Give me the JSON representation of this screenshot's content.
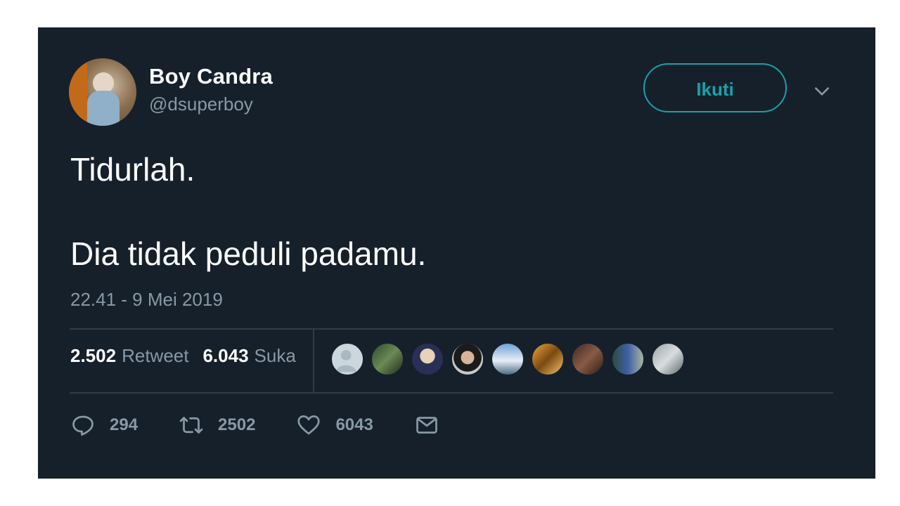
{
  "tweet": {
    "author": {
      "name": "Boy Candra",
      "handle": "@dsuperboy"
    },
    "follow_label": "Ikuti",
    "more_icon": "chevron-down-icon",
    "text_lines": [
      "Tidurlah.",
      "Dia tidak peduli padamu."
    ],
    "timestamp": "22.41 - 9 Mei 2019",
    "stats": {
      "retweets_count": "2.502",
      "retweets_label": "Retweet",
      "likes_count": "6.043",
      "likes_label": "Suka"
    },
    "actions": {
      "reply_count": "294",
      "retweet_count": "2502",
      "like_count": "6043"
    },
    "colors": {
      "background": "#16202b",
      "accent": "#1aa1a9",
      "muted_text": "#8899a6",
      "divider": "#2f3c48"
    }
  }
}
